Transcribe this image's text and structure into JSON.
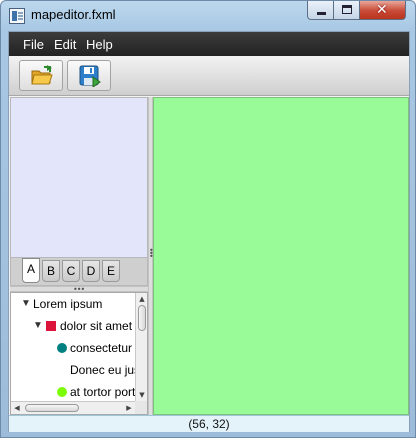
{
  "window": {
    "title": "mapeditor.fxml",
    "controls": {
      "minimize_icon": "minimize-icon",
      "maximize_icon": "maximize-icon",
      "close_glyph": "✕"
    }
  },
  "menubar": {
    "items": [
      {
        "label": "File"
      },
      {
        "label": "Edit"
      },
      {
        "label": "Help"
      }
    ]
  },
  "toolbar": {
    "buttons": [
      {
        "name": "open",
        "icon": "open-folder-icon"
      },
      {
        "name": "save",
        "icon": "save-icon"
      }
    ]
  },
  "tabs": {
    "items": [
      {
        "label": "A"
      },
      {
        "label": "B"
      },
      {
        "label": "C"
      },
      {
        "label": "D"
      },
      {
        "label": "E"
      }
    ],
    "selected": "A"
  },
  "tree": {
    "rows": [
      {
        "label": "Lorem ipsum",
        "expanded": true
      },
      {
        "label": "dolor sit amet",
        "expanded": true,
        "marker_color": "#dc143c"
      },
      {
        "label": "consectetur",
        "marker_color": "#008080"
      },
      {
        "label": "Donec eu justo"
      },
      {
        "label": "at tortor porta",
        "marker_color": "#7cfc00"
      }
    ]
  },
  "canvas": {
    "color": "#98fb98"
  },
  "status": {
    "coords": "(56, 32)"
  }
}
